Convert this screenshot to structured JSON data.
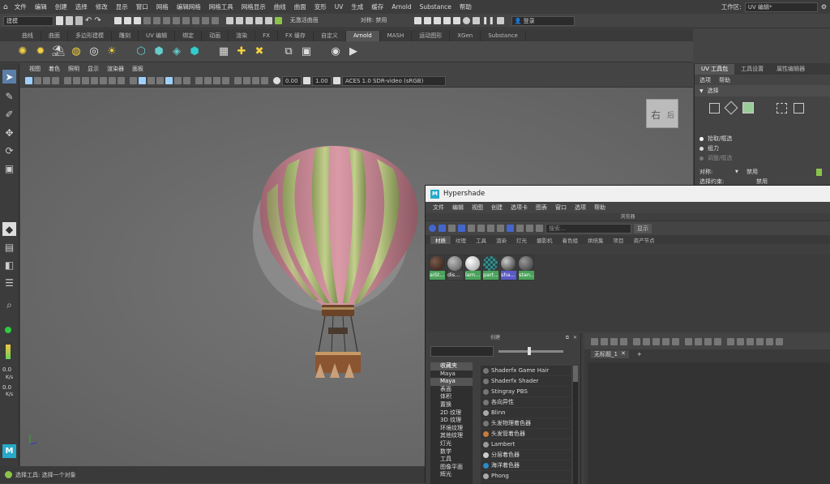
{
  "menubar": {
    "items": [
      "文件",
      "编辑",
      "创建",
      "选择",
      "修改",
      "显示",
      "窗口",
      "网格",
      "编辑网格",
      "网格工具",
      "网格显示",
      "曲线",
      "曲面",
      "变形",
      "UV",
      "生成",
      "缓存",
      "Arnold",
      "Substance",
      "帮助"
    ],
    "workspace_label": "工作区:",
    "workspace_value": "UV 编辑*"
  },
  "status_line": {
    "mode": "建模",
    "live_surface": "无激活曲面",
    "symmetry": "对称: 禁用",
    "login": "登录"
  },
  "shelf_tabs": [
    "曲线",
    "曲面",
    "多边形建模",
    "雕刻",
    "UV 编辑",
    "绑定",
    "动画",
    "渲染",
    "FX",
    "FX 缓存",
    "自定义",
    "Arnold",
    "MASH",
    "运动图形",
    "XGen",
    "Substance"
  ],
  "shelf_active": "Arnold",
  "viewport": {
    "menu": [
      "视图",
      "着色",
      "照明",
      "显示",
      "渲染器",
      "面板"
    ],
    "near_value": "0.00",
    "far_value": "1.00",
    "color_space": "ACES 1.0 SDR-video (sRGB)",
    "viewcube_right": "右",
    "viewcube_back": "后"
  },
  "left_toolbar": {
    "value1": "0.0",
    "unit1": "K/s",
    "value2": "0.0",
    "unit2": "K/s"
  },
  "status": {
    "message": "选择工具: 选择一个对象"
  },
  "right_panel": {
    "tabs": [
      "UV 工具包",
      "工具设置",
      "属性编辑器"
    ],
    "menu": [
      "选项",
      "帮助"
    ],
    "section": "选择",
    "radios": [
      "拾取/框选",
      "组力",
      "调整/框选"
    ],
    "symmetry_label": "对称:",
    "symmetry_value": "禁用",
    "constraint_label": "选择约束:",
    "constraint_value": "禁用"
  },
  "hypershade": {
    "title": "Hypershade",
    "menu": [
      "文件",
      "编辑",
      "视图",
      "创建",
      "选项卡",
      "图表",
      "窗口",
      "选项",
      "帮助"
    ],
    "browser_label": "浏览器",
    "search_placeholder": "搜索...",
    "show_button": "显示",
    "tabs": [
      "材质",
      "纹理",
      "工具",
      "渲染",
      "灯光",
      "摄影机",
      "着色组",
      "烘焙集",
      "项目",
      "资产节点"
    ],
    "materials": [
      {
        "label": "aiSt...",
        "color": "#3a2a22"
      },
      {
        "label": "dis...",
        "color": "#888888"
      },
      {
        "label": "lam...",
        "color": "#f2f2f2"
      },
      {
        "label": "part...",
        "color": "#2e6b6b"
      },
      {
        "label": "sha...",
        "color": "#555555"
      },
      {
        "label": "stan...",
        "color": "#666666"
      }
    ],
    "create_label": "创建",
    "categories": [
      "收藏夹",
      "Maya",
      "Maya",
      "表面",
      "体积",
      "置换",
      "2D 纹理",
      "3D 纹理",
      "环境纹理",
      "其他纹理",
      "灯光",
      "数学",
      "工具",
      "图像平面",
      "辉光"
    ],
    "nodes": [
      "Shaderfx Game Hair",
      "Shaderfx Shader",
      "Stingray PBS",
      "各向异性",
      "Blinn",
      "头发物理着色器",
      "头发管着色器",
      "Lambert",
      "分层着色器",
      "海洋着色器",
      "Phong"
    ],
    "graph_tab": "无标题_1",
    "graph_tab_add": "+"
  }
}
